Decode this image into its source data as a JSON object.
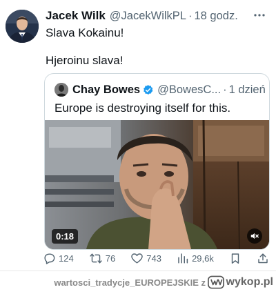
{
  "tweet": {
    "author_name": "Jacek Wilk",
    "author_handle": "@JacekWilkPL",
    "separator": "·",
    "time": "18 godz.",
    "text_line1": "Slava Kokainu!",
    "text_line2": "Hjeroinu slava!",
    "avatar_icon": "profile-photo"
  },
  "quote": {
    "author_name": "Chay Bowes",
    "author_handle": "@BowesC...",
    "separator": "·",
    "time": "1 dzień",
    "text": "Europe is destroying itself for this.",
    "verified_icon": "verified-badge-icon",
    "video": {
      "duration": "0:18",
      "mute_icon": "muted-speaker-icon"
    }
  },
  "actions": {
    "replies": "124",
    "reposts": "76",
    "likes": "743",
    "views": "29,6k"
  },
  "footer": {
    "text": "wartosci_tradycje_EUROPEJSKIE",
    "suffix": "z",
    "brand": "wykop.pl"
  },
  "colors": {
    "verified_blue": "#1d9bf0",
    "secondary_text": "#536471",
    "border": "#cfd9de"
  }
}
